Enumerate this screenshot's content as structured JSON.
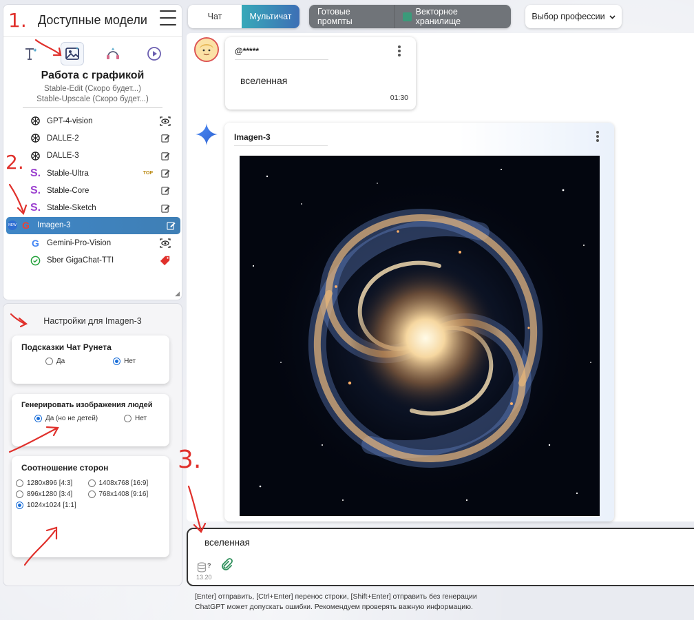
{
  "sidebar": {
    "title": "Доступные модели",
    "mode_icons": [
      "text-icon",
      "image-icon",
      "audio-icon",
      "video-icon"
    ],
    "section_title": "Работа с графикой",
    "coming_soon": [
      "Stable-Edit (Скоро будет...)",
      "Stable-Upscale (Скоро будет...)"
    ],
    "models": [
      {
        "label": "GPT-4-vision",
        "icon": "openai-icon",
        "action": "eye-icon",
        "active": false
      },
      {
        "label": "DALLE-2",
        "icon": "openai-icon",
        "action": "edit-icon",
        "active": false
      },
      {
        "label": "DALLE-3",
        "icon": "openai-icon",
        "action": "edit-icon",
        "active": false
      },
      {
        "label": "Stable-Ultra",
        "icon": "stability-icon",
        "action": "edit-icon",
        "badge": "TOP",
        "active": false
      },
      {
        "label": "Stable-Core",
        "icon": "stability-icon",
        "action": "edit-icon",
        "active": false
      },
      {
        "label": "Stable-Sketch",
        "icon": "stability-icon",
        "action": "edit-icon",
        "active": false
      },
      {
        "label": "Imagen-3",
        "icon": "google-icon",
        "action": "edit-icon",
        "badge": "NEW",
        "active": true
      },
      {
        "label": "Gemini-Pro-Vision",
        "icon": "google-icon",
        "action": "eye-icon",
        "active": false
      },
      {
        "label": "Sber GigaChat-TTI",
        "icon": "sber-icon",
        "action": "price-tag-icon",
        "active": false
      }
    ]
  },
  "settings": {
    "title": "Настройки для Imagen-3",
    "hints": {
      "title": "Подсказки Чат Рунета",
      "yes": "Да",
      "no": "Нет",
      "selected": "Нет"
    },
    "people": {
      "title": "Генерировать изображения людей",
      "yes": "Да (но не детей)",
      "no": "Нет",
      "selected": "Да (но не детей)"
    },
    "ratio": {
      "title": "Соотношение сторон",
      "options": [
        "1280x896 [4:3]",
        "1408x768 [16:9]",
        "896x1280 [3:4]",
        "768x1408 [9:16]",
        "1024x1024 [1:1]"
      ],
      "selected": "1024x1024 [1:1]"
    }
  },
  "topbar": {
    "chat": "Чат",
    "multichat": "Мультичат",
    "prompts": "Готовые промпты",
    "vector": "Векторное хранилище",
    "profession": "Выбор профессии"
  },
  "messages": {
    "user": {
      "name": "@*****",
      "text": "вселенная",
      "time": "01:30"
    },
    "ai": {
      "name": "Imagen-3",
      "image": "spiral-galaxy-image"
    }
  },
  "input": {
    "value": "вселенная",
    "counter": "13.20",
    "db_badge": "?"
  },
  "footer": {
    "hint1": "[Enter] отправить, [Ctrl+Enter] перенос строки, [Shift+Enter] отправить без генерации",
    "hint2": "ChatGPT может допускать ошибки. Рекомендуем проверять важную информацию."
  },
  "annotations": [
    "1.",
    "2.",
    "3."
  ],
  "colors": {
    "accent": "#3f86c6",
    "multichat_from": "#38a9b9",
    "multichat_to": "#3d6fb5",
    "annotation": "#e0302b"
  }
}
